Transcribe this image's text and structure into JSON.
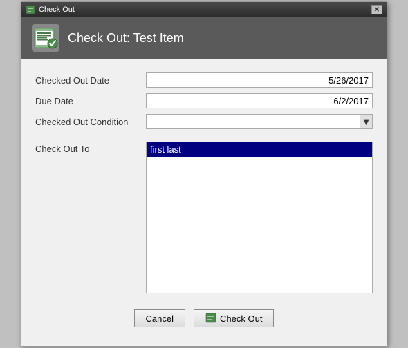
{
  "window": {
    "title": "Check Out",
    "header_title": "Check Out: Test Item"
  },
  "form": {
    "checked_out_date_label": "Checked Out Date",
    "checked_out_date_value": "5/26/2017",
    "due_date_label": "Due Date",
    "due_date_value": "6/2/2017",
    "checked_out_condition_label": "Checked Out Condition",
    "checked_out_condition_value": "",
    "check_out_to_label": "Check Out To",
    "check_out_to_selected": "first last"
  },
  "buttons": {
    "cancel_label": "Cancel",
    "checkout_label": "Check Out"
  },
  "icons": {
    "dropdown_arrow": "▼",
    "checkout_icon": "🗓"
  }
}
